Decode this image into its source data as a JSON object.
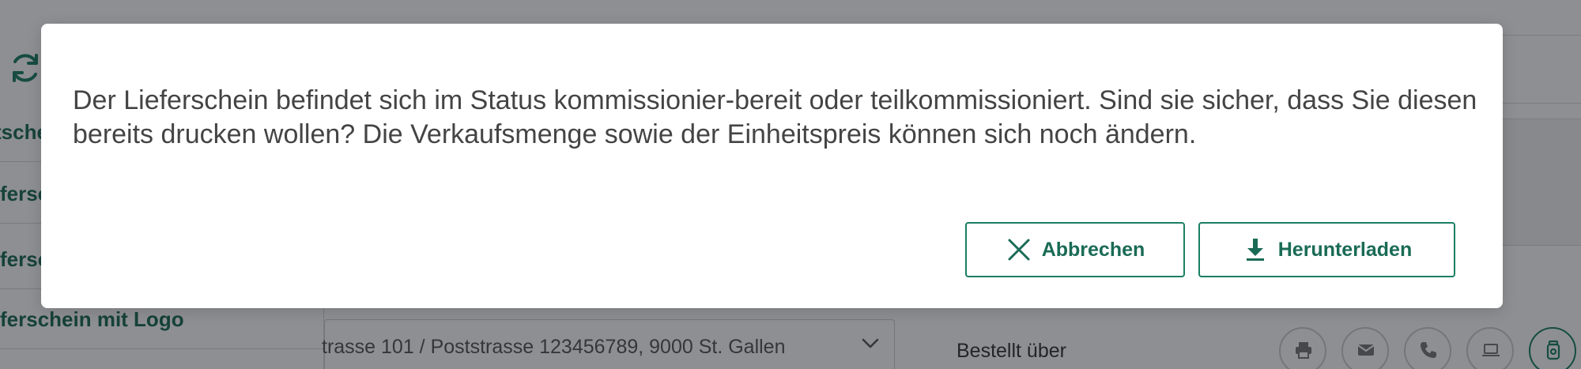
{
  "background": {
    "sidebar": {
      "items": [
        {
          "label": "tsche"
        },
        {
          "label": "ferscl"
        },
        {
          "label": "ferscl"
        },
        {
          "label": "ferschein mit Logo"
        }
      ]
    },
    "address_select": {
      "value": "trasse 101  / Poststrasse 123456789, 9000 St. Gallen"
    },
    "ordered_via_label": "Bestellt über",
    "contact_channels": [
      "printer-icon",
      "mail-icon",
      "phone-icon",
      "laptop-icon",
      "jar-icon"
    ]
  },
  "dialog": {
    "message": "Der Lieferschein befindet sich im Status kommissionier-bereit oder teilkommissioniert. Sind sie sicher, dass Sie diesen bereits drucken wollen? Die Verkaufsmenge sowie der Einheitspreis können sich noch ändern.",
    "cancel_label": "Abbrechen",
    "download_label": "Herunterladen"
  },
  "colors": {
    "accent": "#1a7f64",
    "overlay": "rgba(18,20,30,0.48)"
  }
}
